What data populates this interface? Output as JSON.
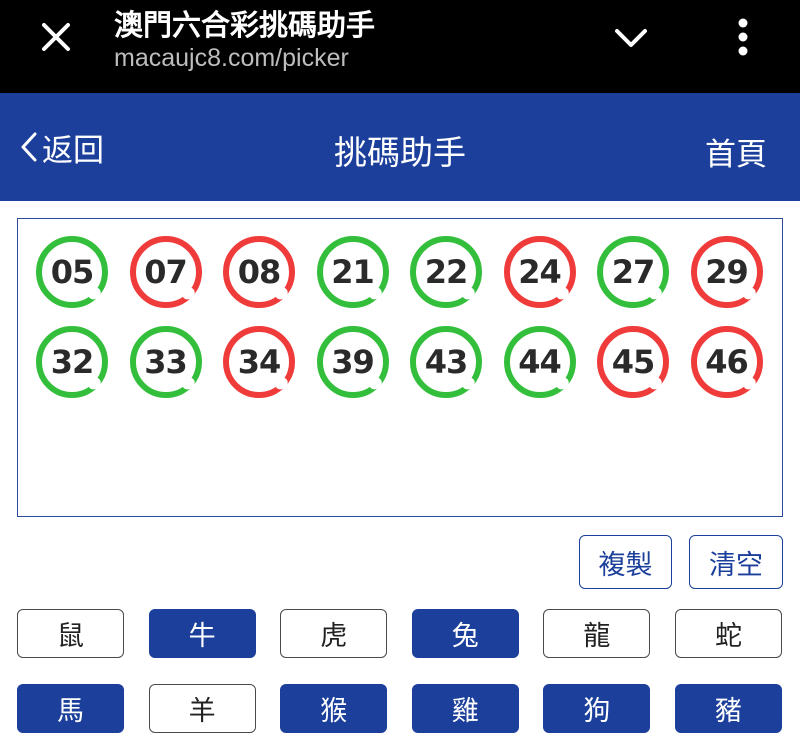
{
  "browser": {
    "page_title": "澳門六合彩挑碼助手",
    "url": "macaujc8.com/picker"
  },
  "header": {
    "back_label": "返回",
    "title": "挑碼助手",
    "home_label": "首頁"
  },
  "selected_numbers": [
    {
      "number": "05",
      "color": "green"
    },
    {
      "number": "07",
      "color": "red"
    },
    {
      "number": "08",
      "color": "red"
    },
    {
      "number": "21",
      "color": "green"
    },
    {
      "number": "22",
      "color": "green"
    },
    {
      "number": "24",
      "color": "red"
    },
    {
      "number": "27",
      "color": "green"
    },
    {
      "number": "29",
      "color": "red"
    },
    {
      "number": "32",
      "color": "green"
    },
    {
      "number": "33",
      "color": "green"
    },
    {
      "number": "34",
      "color": "red"
    },
    {
      "number": "39",
      "color": "green"
    },
    {
      "number": "43",
      "color": "green"
    },
    {
      "number": "44",
      "color": "green"
    },
    {
      "number": "45",
      "color": "red"
    },
    {
      "number": "46",
      "color": "red"
    }
  ],
  "actions": {
    "copy_label": "複製",
    "clear_label": "清空"
  },
  "zodiacs": [
    {
      "label": "鼠",
      "selected": false
    },
    {
      "label": "牛",
      "selected": true
    },
    {
      "label": "虎",
      "selected": false
    },
    {
      "label": "兔",
      "selected": true
    },
    {
      "label": "龍",
      "selected": false
    },
    {
      "label": "蛇",
      "selected": false
    },
    {
      "label": "馬",
      "selected": true
    },
    {
      "label": "羊",
      "selected": false
    },
    {
      "label": "猴",
      "selected": true
    },
    {
      "label": "雞",
      "selected": true
    },
    {
      "label": "狗",
      "selected": true
    },
    {
      "label": "豬",
      "selected": true
    }
  ],
  "colors": {
    "brand_blue": "#1b3f9a",
    "ball_green": "#33bf3c",
    "ball_red": "#f03b3b"
  },
  "icons": {
    "close": "close-icon",
    "chevron": "chevron-down-icon",
    "more": "more-vertical-icon",
    "back": "chevron-left-icon"
  }
}
